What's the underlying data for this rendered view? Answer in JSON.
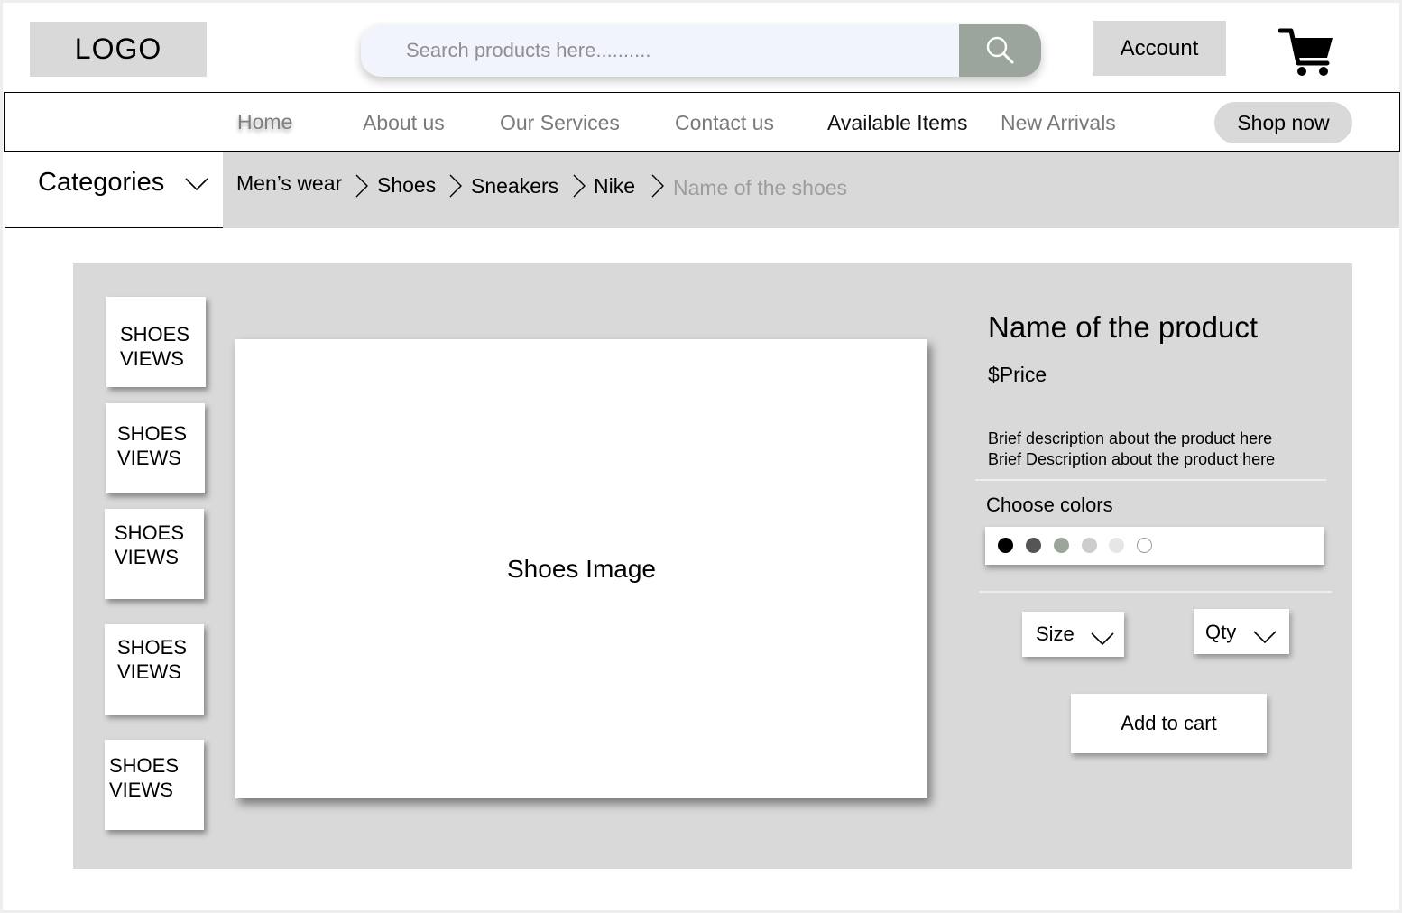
{
  "header": {
    "logo": "LOGO",
    "search_placeholder": "Search products here..........",
    "account_label": "Account"
  },
  "nav": {
    "items": [
      {
        "label": "Home"
      },
      {
        "label": "About us"
      },
      {
        "label": "Our Services"
      },
      {
        "label": "Contact us"
      },
      {
        "label": "Available Items"
      },
      {
        "label": "New Arrivals"
      }
    ],
    "shop_now_label": "Shop now"
  },
  "categories_label": "Categories",
  "breadcrumb": [
    "Men’s wear",
    "Shoes",
    "Sneakers",
    "Nike",
    "Name of the shoes"
  ],
  "product": {
    "thumbnails": [
      {
        "line1": "SHOES",
        "line2": "VIEWS"
      },
      {
        "line1": "SHOES",
        "line2": "VIEWS"
      },
      {
        "line1": "SHOES",
        "line2": "VIEWS"
      },
      {
        "line1": "SHOES",
        "line2": "VIEWS"
      },
      {
        "line1": "SHOES",
        "line2": "VIEWS"
      }
    ],
    "main_image_label": "Shoes Image",
    "name": "Name of the product",
    "price": "$Price",
    "description": [
      "Brief description about the product here",
      "Brief Description about the product here"
    ],
    "colors_label": "Choose colors",
    "colors": [
      "#000000",
      "#555555",
      "#9ba59b",
      "#cccccc",
      "#e6e6e6",
      "#ffffff"
    ],
    "size_label": "Size",
    "qty_label": "Qty",
    "add_to_cart_label": "Add to cart"
  }
}
